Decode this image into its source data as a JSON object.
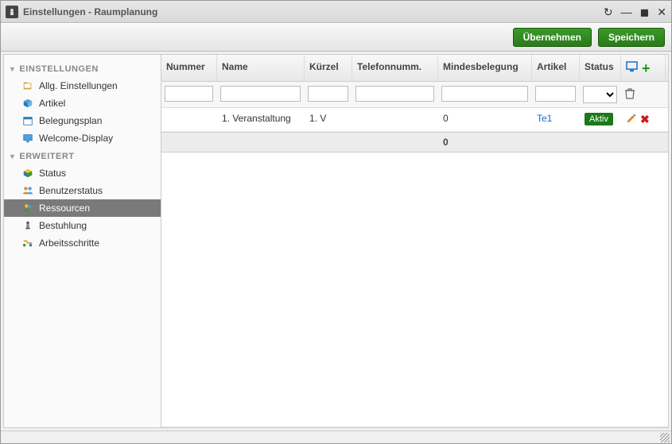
{
  "window": {
    "title": "Einstellungen - Raumplanung"
  },
  "toolbar": {
    "apply": "Übernehmen",
    "save": "Speichern"
  },
  "sidebar": {
    "groups": [
      {
        "header": "EINSTELLUNGEN",
        "items": [
          {
            "label": "Allg. Einstellungen",
            "icon": "book-icon"
          },
          {
            "label": "Artikel",
            "icon": "cube-icon"
          },
          {
            "label": "Belegungsplan",
            "icon": "calendar-icon"
          },
          {
            "label": "Welcome-Display",
            "icon": "monitor-icon"
          }
        ]
      },
      {
        "header": "ERWEITERT",
        "items": [
          {
            "label": "Status",
            "icon": "cube-color-icon"
          },
          {
            "label": "Benutzerstatus",
            "icon": "users-icon"
          },
          {
            "label": "Ressourcen",
            "icon": "people-icon",
            "selected": true
          },
          {
            "label": "Bestuhlung",
            "icon": "chair-icon"
          },
          {
            "label": "Arbeitsschritte",
            "icon": "steps-icon"
          }
        ]
      }
    ]
  },
  "grid": {
    "columns": {
      "nummer": "Nummer",
      "name": "Name",
      "kuerzel": "Kürzel",
      "telefon": "Telefonnumm.",
      "mindesbelegung": "Mindesbelegung",
      "artikel": "Artikel",
      "status": "Status"
    },
    "rows": [
      {
        "nummer": "",
        "name": "1. Veranstaltung",
        "kuerzel": "1. V",
        "telefon": "",
        "mindesbelegung": "0",
        "artikel": "Te1",
        "status": "Aktiv"
      }
    ],
    "summary": {
      "mindesbelegung": "0"
    }
  }
}
